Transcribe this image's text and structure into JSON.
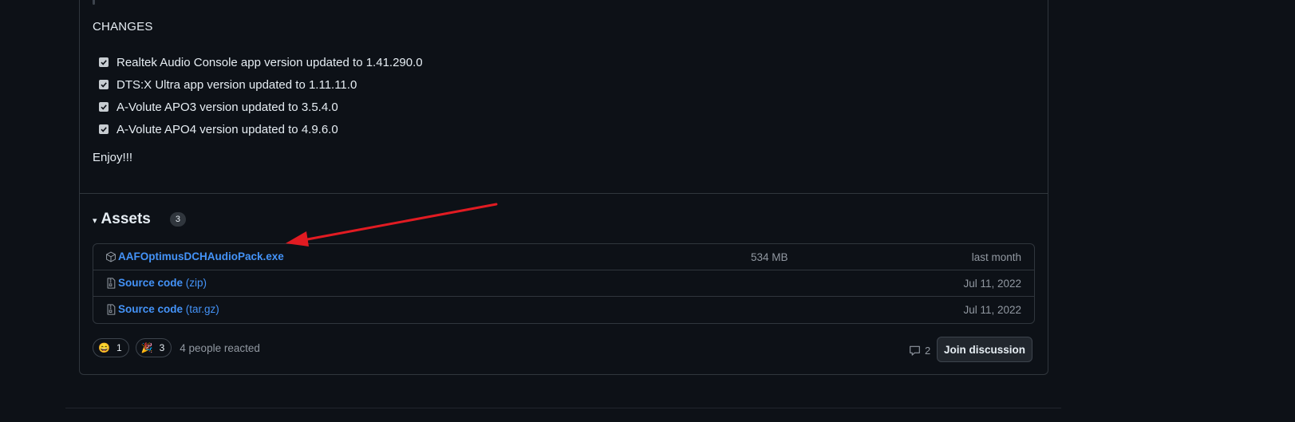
{
  "changes": {
    "heading": "CHANGES",
    "items": [
      "Realtek Audio Console app version updated to 1.41.290.0",
      "DTS:X Ultra app version updated to 1.11.11.0",
      "A-Volute APO3 version updated to 3.5.4.0",
      "A-Volute APO4 version updated to 4.9.6.0"
    ],
    "closing": "Enjoy!!!"
  },
  "assets": {
    "caret": "▾",
    "title": "Assets",
    "count": "3",
    "rows": [
      {
        "icon": "package-icon",
        "name": "AAFOptimusDCHAudioPack.exe",
        "suffix": "",
        "size": "534 MB",
        "date": "last month"
      },
      {
        "icon": "file-zip-icon",
        "name": "Source code",
        "suffix": " (zip)",
        "size": "",
        "date": "Jul 11, 2022"
      },
      {
        "icon": "file-zip-icon",
        "name": "Source code",
        "suffix": " (tar.gz)",
        "size": "",
        "date": "Jul 11, 2022"
      }
    ]
  },
  "reactions": {
    "items": [
      {
        "icon": "smile-emoji-icon",
        "emoji": "😄",
        "count": "1"
      },
      {
        "icon": "party-popper-icon",
        "emoji": "🎉",
        "count": "3"
      }
    ],
    "summary": "4 people reacted"
  },
  "discussion": {
    "comment_icon": "comment-icon",
    "comment_count": "2",
    "join_label": "Join discussion"
  },
  "annotation": {
    "arrow_color": "#e11b22"
  },
  "colors": {
    "background": "#0d1117",
    "link": "#4493f8",
    "muted": "#9198a1",
    "border": "#30363d"
  }
}
